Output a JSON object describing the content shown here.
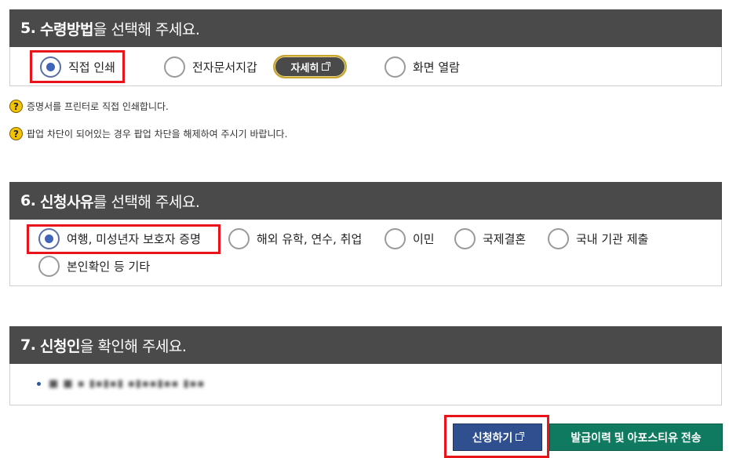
{
  "section5": {
    "num": "5.",
    "bold": "수령방법",
    "rest": "을 선택해 주세요.",
    "options": [
      "직접 인쇄",
      "전자문서지갑",
      "화면 열람"
    ],
    "selected_index": 0,
    "detail_button": "자세히"
  },
  "notes": [
    "증명서를 프린터로 직접 인쇄합니다.",
    "팝업 차단이 되어있는 경우 팝업 차단을 해제하여 주시기 바랍니다."
  ],
  "note_icon_glyph": "?",
  "section6": {
    "num": "6.",
    "bold": "신청사유",
    "rest": "를 선택해 주세요.",
    "options": [
      "여행, 미성년자 보호자 증명",
      "해외 유학, 연수, 취업",
      "이민",
      "국제결혼",
      "국내 기관 제출",
      "본인확인 등 기타"
    ],
    "selected_index": 0
  },
  "section7": {
    "num": "7.",
    "bold": "신청인",
    "rest": "을 확인해 주세요.",
    "applicant_masked": "■ ■ ▪ ▮▪▮▪▮ ▪▮▪▪▮▪▪ ▮▪▪"
  },
  "buttons": {
    "apply": "신청하기",
    "send": "발급이력 및 아포스티유 전송"
  },
  "colors": {
    "header_bg": "#4a4a4a",
    "radio_selected": "#3f64b8",
    "highlight": "#e8141a",
    "apply_bg": "#2f4f8f",
    "send_bg": "#0f7a5f",
    "note_icon": "#f5c400"
  }
}
